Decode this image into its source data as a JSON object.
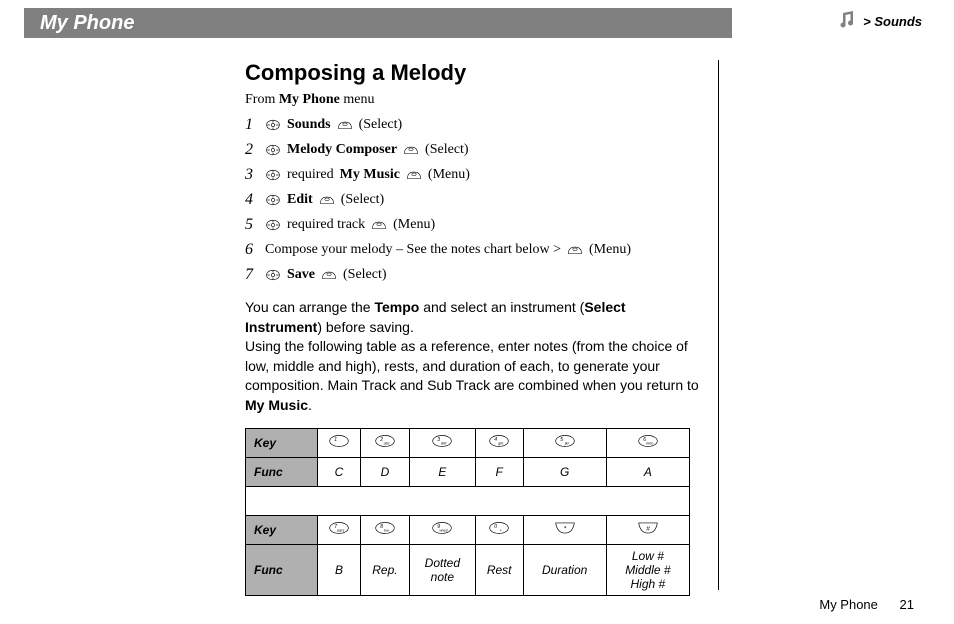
{
  "header": {
    "title": "My Phone"
  },
  "breadcrumb": {
    "text": "> Sounds"
  },
  "page": {
    "heading": "Composing a Melody",
    "from_prefix": "From ",
    "from_bold": "My Phone",
    "from_suffix": " menu"
  },
  "steps": [
    {
      "num": "1",
      "pre": "",
      "bold": "Sounds",
      "post": "",
      "action": "(Select)",
      "hasNav": true
    },
    {
      "num": "2",
      "pre": "",
      "bold": "Melody Composer",
      "post": "",
      "action": "(Select)",
      "hasNav": true
    },
    {
      "num": "3",
      "pre": "required ",
      "bold": "My Music",
      "post": "",
      "action": "(Menu)",
      "hasNav": true
    },
    {
      "num": "4",
      "pre": "",
      "bold": "Edit",
      "post": "",
      "action": "(Select)",
      "hasNav": true
    },
    {
      "num": "5",
      "pre": "required track",
      "bold": "",
      "post": "",
      "action": "(Menu)",
      "hasNav": true
    },
    {
      "num": "6",
      "pre": "Compose your melody – See the notes chart below >",
      "bold": "",
      "post": "",
      "action": "(Menu)",
      "hasNav": false
    },
    {
      "num": "7",
      "pre": "",
      "bold": "Save",
      "post": "",
      "action": "(Select)",
      "hasNav": true
    }
  ],
  "paragraph": {
    "p1a": "You can arrange the ",
    "p1b": "Tempo",
    "p1c": " and select an instrument (",
    "p1d": "Select Instrument",
    "p1e": ") before saving.",
    "p2a": "Using the following table as a reference, enter notes (from the choice of low, middle and high), rests, and duration of each, to generate your composition. Main Track and Sub Track are combined when you return to ",
    "p2b": "My Music",
    "p2c": "."
  },
  "table": {
    "labels": {
      "key": "Key",
      "func": "Func"
    },
    "row1": {
      "keys": [
        "1",
        "2 abc",
        "3 def",
        "4 ghi",
        "5 jkl",
        "6 mno"
      ],
      "funcs": [
        "C",
        "D",
        "E",
        "F",
        "G",
        "A"
      ]
    },
    "row2": {
      "keys": [
        "7 pqrs",
        "8 tuv",
        "9 wxyz",
        "0 +",
        "*",
        "#"
      ],
      "funcs": [
        "B",
        "Rep.",
        "Dotted note",
        "Rest",
        "Duration",
        "Low # Middle # High #"
      ]
    }
  },
  "footer": {
    "section": "My Phone",
    "page": "21"
  }
}
